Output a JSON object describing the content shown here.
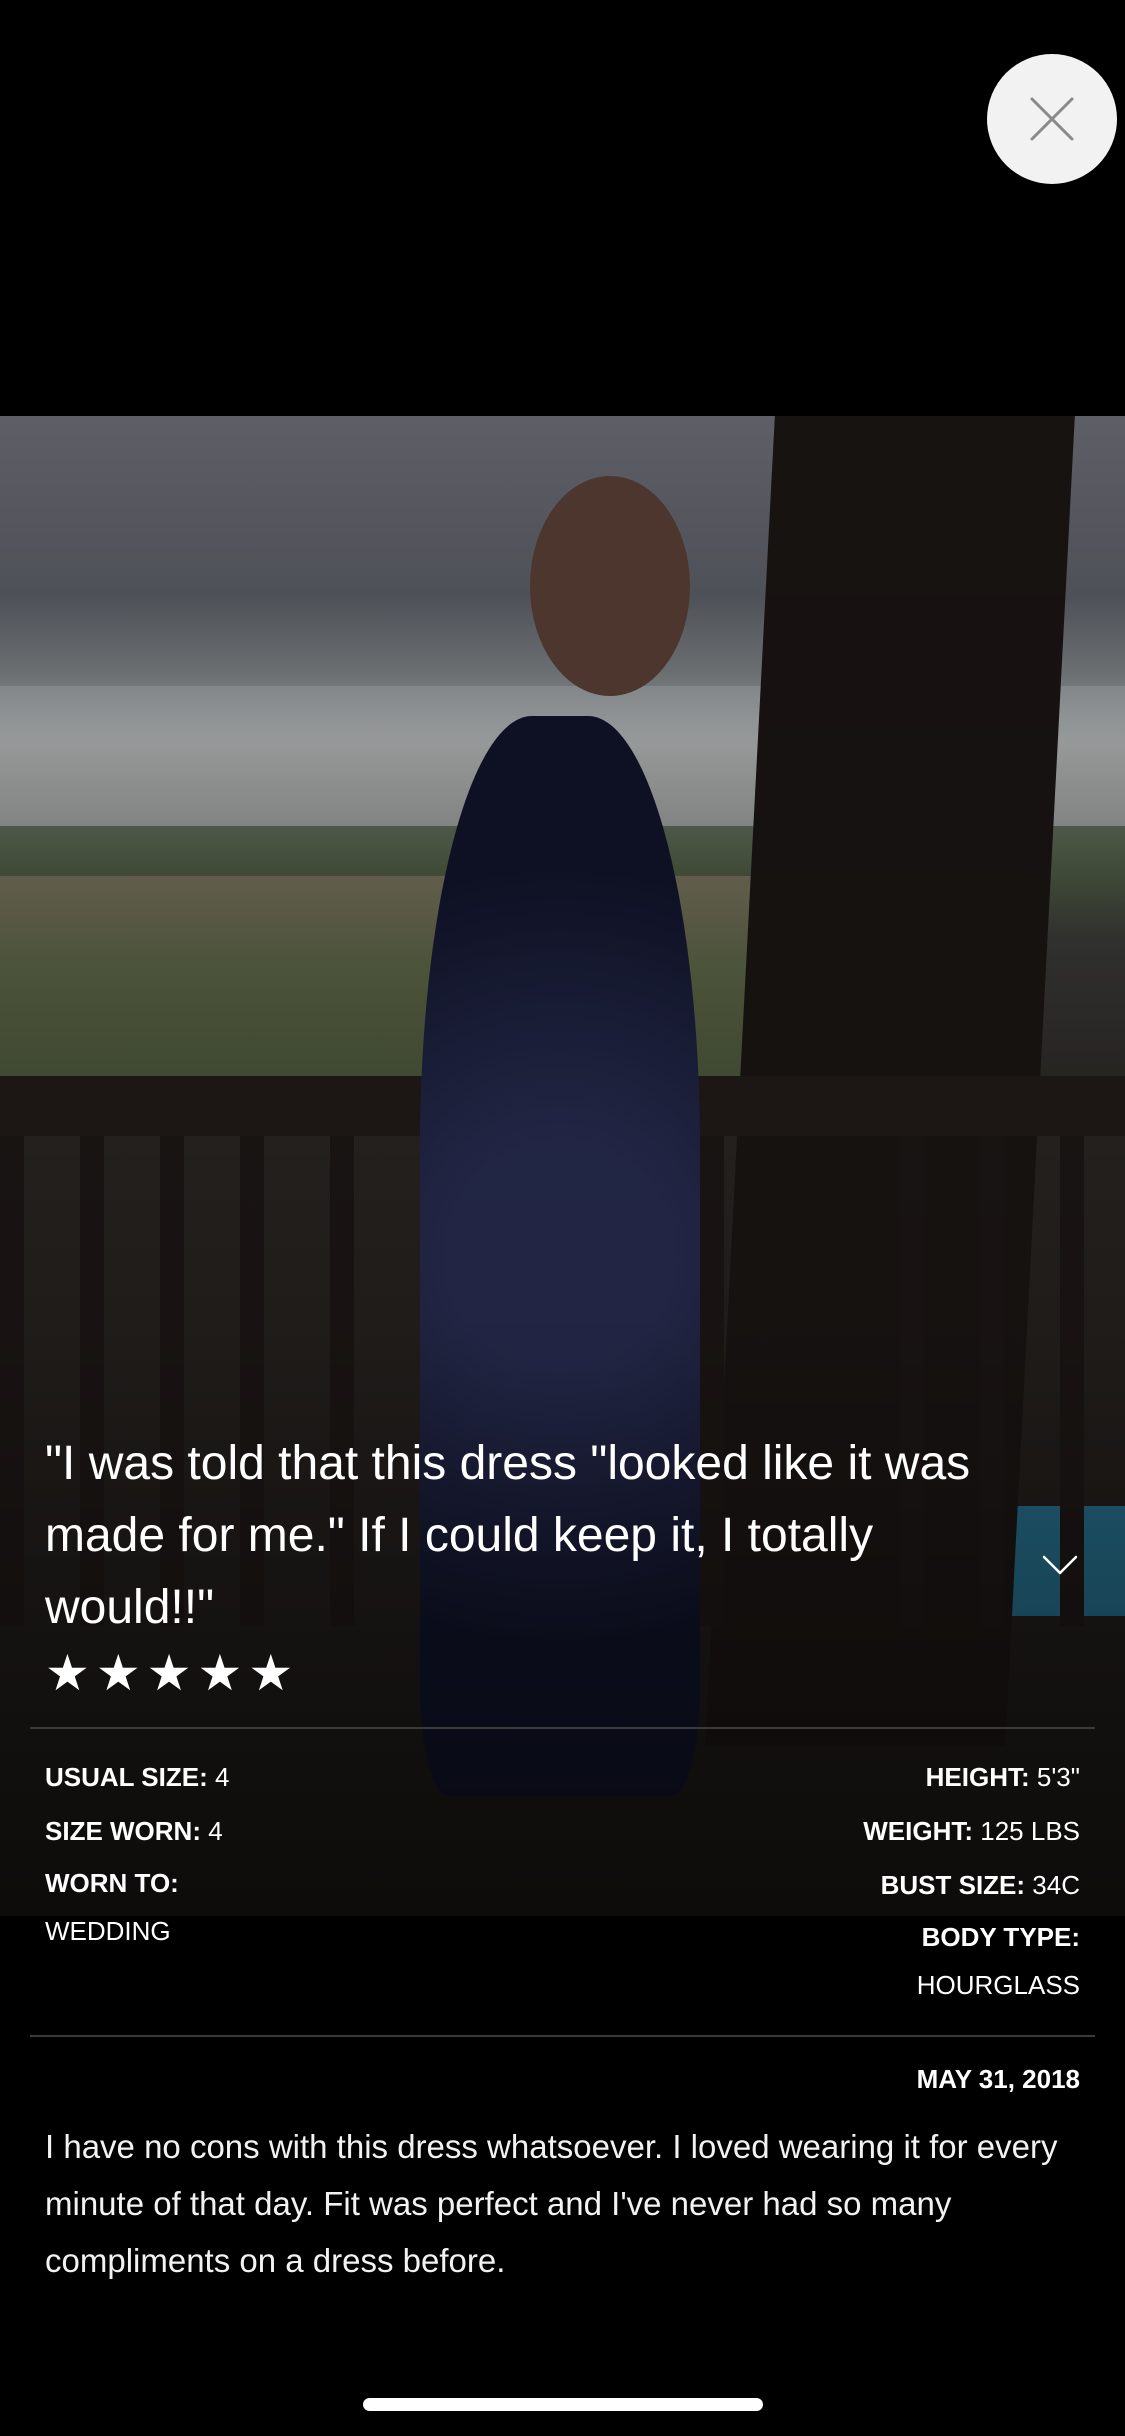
{
  "close_button": {
    "icon": "close-icon"
  },
  "review": {
    "quote": "\"I was told that this dress \"looked like it was made for me.\" If I could keep it, I totally would!!\"",
    "rating": 5,
    "stars": [
      "★",
      "★",
      "★",
      "★",
      "★"
    ],
    "expand_icon": "chevron-down-icon"
  },
  "stats": {
    "usual_size": {
      "label": "USUAL SIZE:",
      "value": "4"
    },
    "size_worn": {
      "label": "SIZE WORN:",
      "value": "4"
    },
    "worn_to": {
      "label": "WORN TO:",
      "value": "WEDDING"
    },
    "height": {
      "label": "HEIGHT:",
      "value": "5'3\""
    },
    "weight": {
      "label": "WEIGHT:",
      "value": "125 LBS"
    },
    "bust_size": {
      "label": "BUST SIZE:",
      "value": "34C"
    },
    "body_type": {
      "label": "BODY TYPE:",
      "value": "HOURGLASS"
    }
  },
  "date": "MAY 31, 2018",
  "body": "I have no cons with this dress whatsoever. I loved wearing it for every minute of that day. Fit was perfect and I've never had so many compliments on a dress before."
}
